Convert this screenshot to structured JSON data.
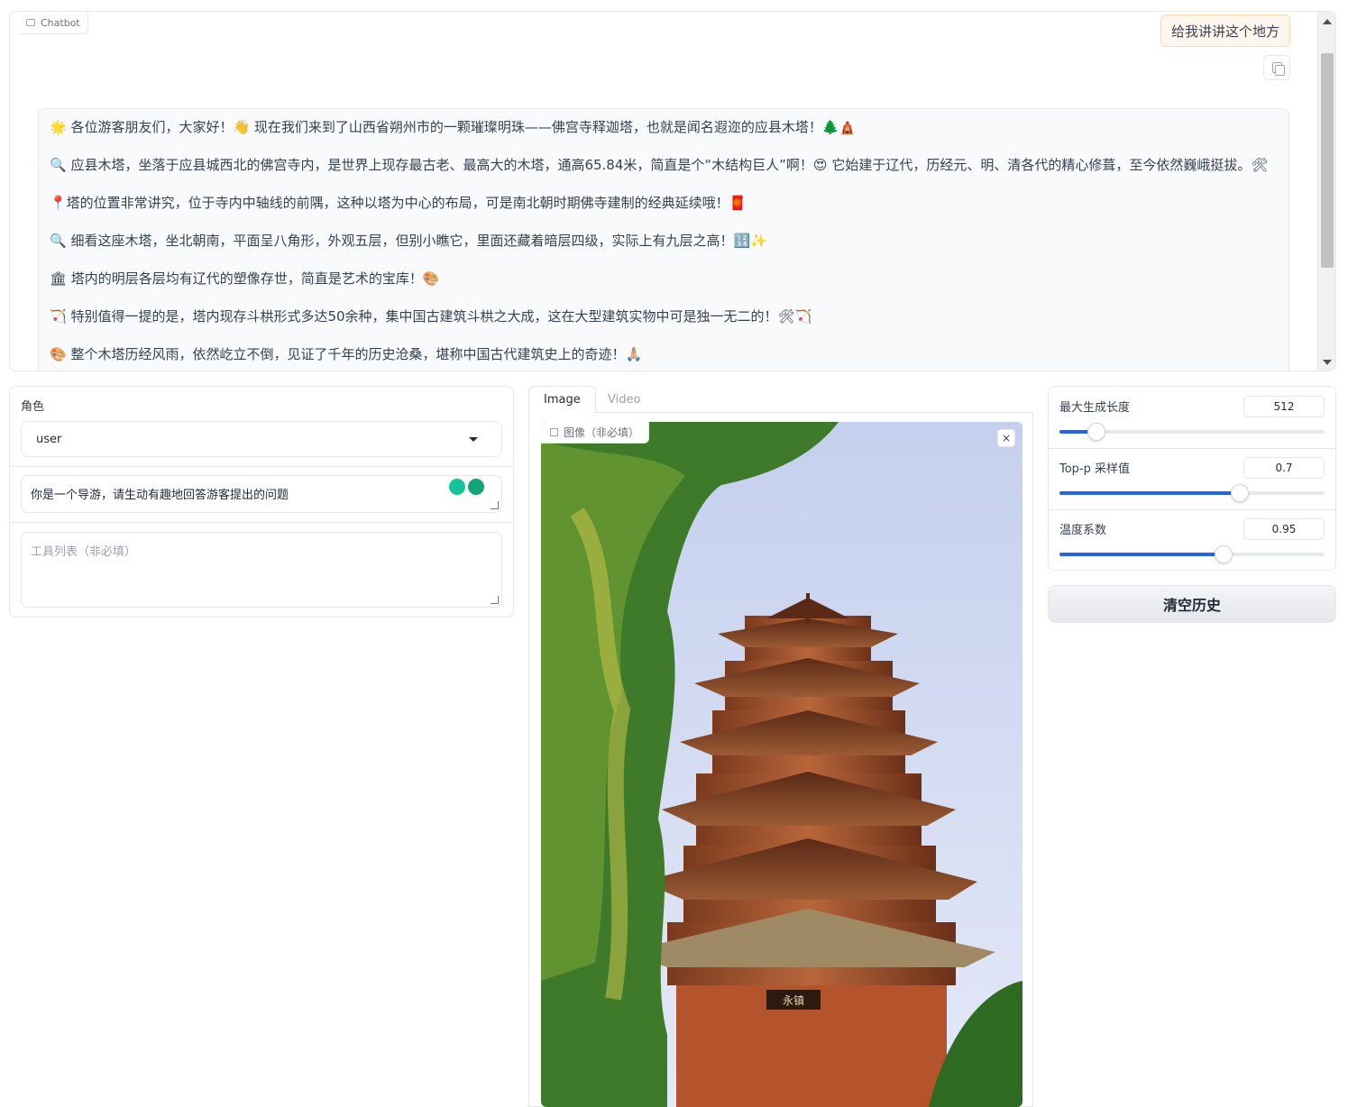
{
  "chatbot": {
    "label": "Chatbot",
    "user_message": "给我讲讲这个地方",
    "bot_paragraphs": [
      "🌟 各位游客朋友们，大家好！👋 现在我们来到了山西省朔州市的一颗璀璨明珠——佛宫寺释迦塔，也就是闻名遐迩的应县木塔！🌲🛕",
      "🔍 应县木塔，坐落于应县城西北的佛宫寺内，是世界上现存最古老、最高大的木塔，通高65.84米，简直是个“木结构巨人”啊！😍 它始建于辽代，历经元、明、清各代的精心修葺，至今依然巍峨挺拔。🛠",
      "📍塔的位置非常讲究，位于寺内中轴线的前隅，这种以塔为中心的布局，可是南北朝时期佛寺建制的经典延续哦！🧧",
      "🔍 细看这座木塔，坐北朝南，平面呈八角形，外观五层，但别小瞧它，里面还藏着暗层四级，实际上有九层之高！🔢✨",
      "🏛 塔内的明层各层均有辽代的塑像存世，简直是艺术的宝库！🎨",
      "🏹 特别值得一提的是，塔内现存斗栱形式多达50余种，集中国古建筑斗栱之大成，这在大型建筑实物中可是独一无二的！🛠🏹",
      "🎨 整个木塔历经风雨，依然屹立不倒，见证了千年的历史沧桑，堪称中国古代建筑史上的奇迹！🙏🏼"
    ]
  },
  "left": {
    "role_label": "角色",
    "role_value": "user",
    "system_prompt": "你是一个导游，请生动有趣地回答游客提出的问题",
    "tools_placeholder": "工具列表（非必填）"
  },
  "media": {
    "tabs": [
      "Image",
      "Video"
    ],
    "image_label": "图像（非必填）",
    "close_symbol": "×",
    "photo_subject": "pagoda-photo",
    "photo_caption_plaque": "永镇"
  },
  "sliders": [
    {
      "label": "最大生成长度",
      "value": "512",
      "fraction": 0.14
    },
    {
      "label": "Top-p 采样值",
      "value": "0.7",
      "fraction": 0.68
    },
    {
      "label": "温度系数",
      "value": "0.95",
      "fraction": 0.62
    }
  ],
  "actions": {
    "clear_label": "清空历史"
  },
  "colors": {
    "accent": "#2563eb",
    "user_bubble": "#fff7ed",
    "bot_bubble": "#f8fafc"
  }
}
